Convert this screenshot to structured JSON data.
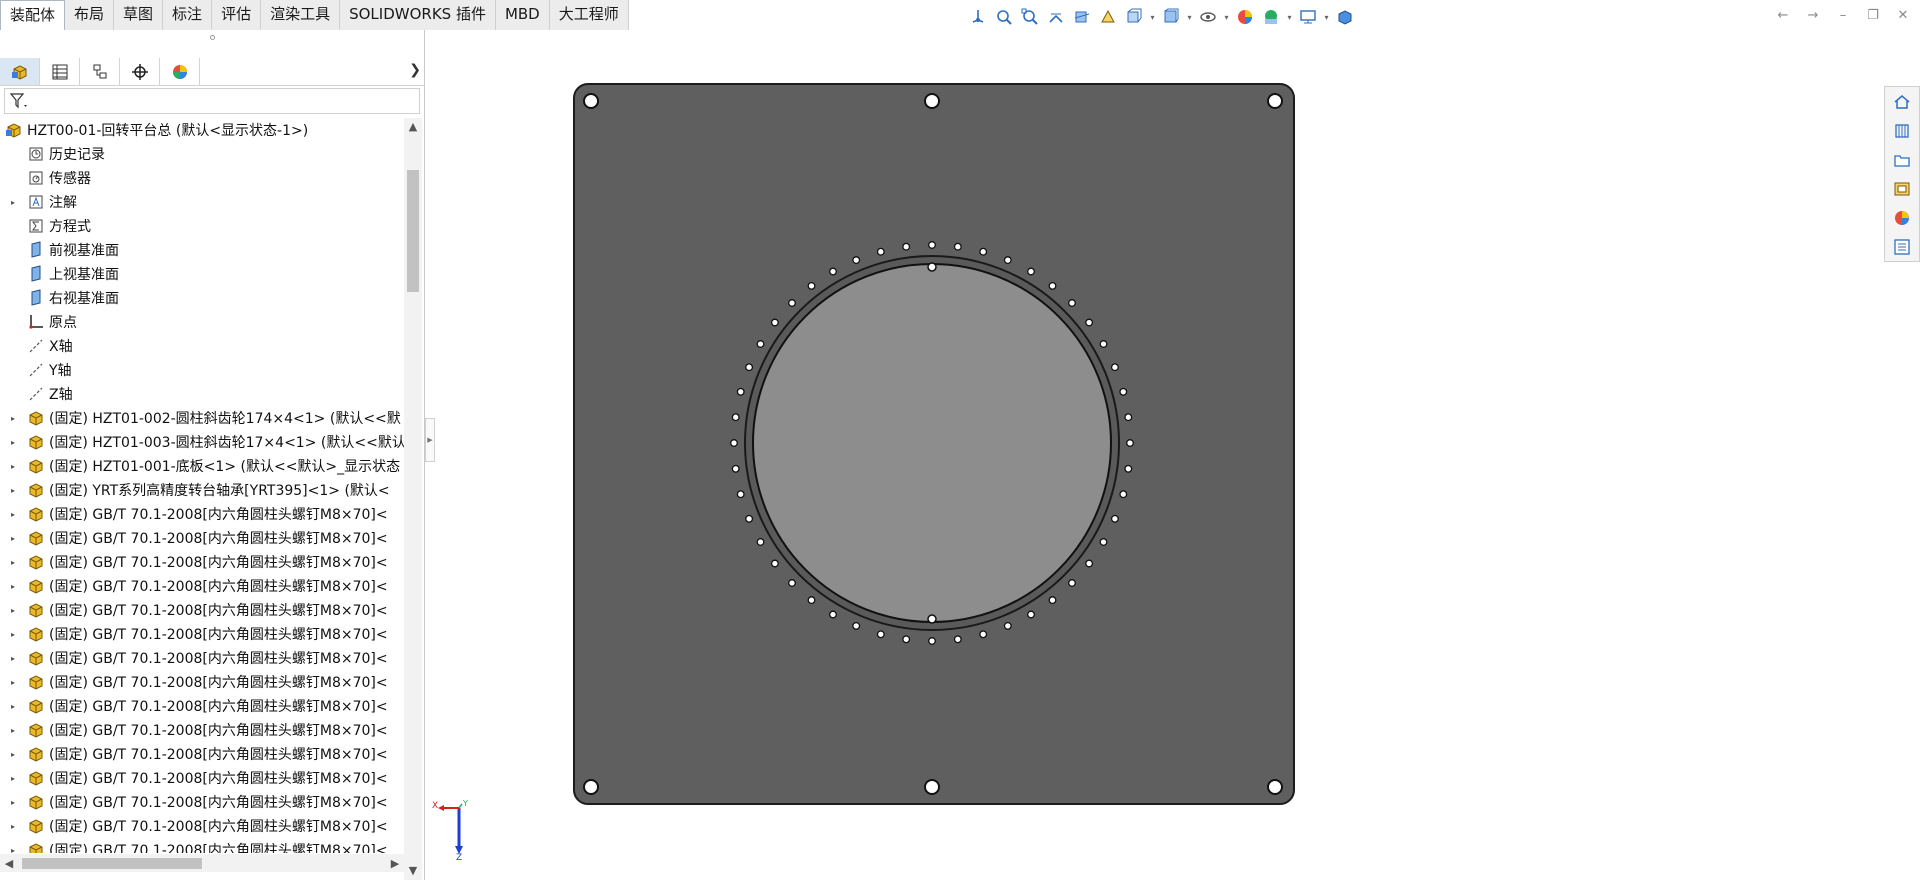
{
  "command_tabs": [
    "装配体",
    "布局",
    "草图",
    "标注",
    "评估",
    "渲染工具",
    "SOLIDWORKS 插件",
    "MBD",
    "大工程师"
  ],
  "active_tab": "装配体",
  "heads_up_toolbar": {
    "icons": [
      "view-orientation-icon",
      "zoom-to-fit-icon",
      "zoom-to-area-icon",
      "previous-view-icon",
      "section-view-icon",
      "dynamic-annotation-icon",
      "view-orientation-dropdown-icon",
      "display-style-icon",
      "hide-show-items-icon",
      "edit-appearance-icon",
      "apply-scene-icon",
      "view-settings-icon",
      "display-pane-icon"
    ]
  },
  "window_controls": [
    "restore-left-icon",
    "restore-right-icon",
    "minimize-icon",
    "restore-icon",
    "close-icon"
  ],
  "manager_tabs": [
    "featuremanager-icon",
    "propertymanager-icon",
    "configurationmanager-icon",
    "dimxpertmanager-icon",
    "displaymanager-icon"
  ],
  "tree": {
    "root": "HZT00-01-回转平台总  (默认<显示状态-1>)",
    "items": [
      {
        "label": "历史记录",
        "icon": "history-icon",
        "expandable": false
      },
      {
        "label": "传感器",
        "icon": "sensor-icon",
        "expandable": false
      },
      {
        "label": "注解",
        "icon": "annotation-icon",
        "expandable": true
      },
      {
        "label": "方程式",
        "icon": "equation-icon",
        "expandable": false
      },
      {
        "label": "前视基准面",
        "icon": "plane-icon",
        "expandable": false
      },
      {
        "label": "上视基准面",
        "icon": "plane-icon",
        "expandable": false
      },
      {
        "label": "右视基准面",
        "icon": "plane-icon",
        "expandable": false
      },
      {
        "label": "原点",
        "icon": "origin-icon",
        "expandable": false
      },
      {
        "label": "X轴",
        "icon": "axis-icon",
        "expandable": false
      },
      {
        "label": "Y轴",
        "icon": "axis-icon",
        "expandable": false
      },
      {
        "label": "Z轴",
        "icon": "axis-icon",
        "expandable": false
      },
      {
        "label": "(固定) HZT01-002-圆柱斜齿轮174×4<1> (默认<<默",
        "icon": "part-icon",
        "expandable": true
      },
      {
        "label": "(固定) HZT01-003-圆柱斜齿轮17×4<1> (默认<<默认",
        "icon": "part-icon",
        "expandable": true
      },
      {
        "label": "(固定) HZT01-001-底板<1> (默认<<默认>_显示状态",
        "icon": "part-icon",
        "expandable": true
      },
      {
        "label": "(固定) YRT系列高精度转台轴承[YRT395]<1> (默认<",
        "icon": "part-icon",
        "expandable": true
      },
      {
        "label": "(固定) GB∕T 70.1-2008[内六角圆柱头螺钉M8×70]<",
        "icon": "part-icon",
        "expandable": true
      },
      {
        "label": "(固定) GB∕T 70.1-2008[内六角圆柱头螺钉M8×70]<",
        "icon": "part-icon",
        "expandable": true
      },
      {
        "label": "(固定) GB∕T 70.1-2008[内六角圆柱头螺钉M8×70]<",
        "icon": "part-icon",
        "expandable": true
      },
      {
        "label": "(固定) GB∕T 70.1-2008[内六角圆柱头螺钉M8×70]<",
        "icon": "part-icon",
        "expandable": true
      },
      {
        "label": "(固定) GB∕T 70.1-2008[内六角圆柱头螺钉M8×70]<",
        "icon": "part-icon",
        "expandable": true
      },
      {
        "label": "(固定) GB∕T 70.1-2008[内六角圆柱头螺钉M8×70]<",
        "icon": "part-icon",
        "expandable": true
      },
      {
        "label": "(固定) GB∕T 70.1-2008[内六角圆柱头螺钉M8×70]<",
        "icon": "part-icon",
        "expandable": true
      },
      {
        "label": "(固定) GB∕T 70.1-2008[内六角圆柱头螺钉M8×70]<",
        "icon": "part-icon",
        "expandable": true
      },
      {
        "label": "(固定) GB∕T 70.1-2008[内六角圆柱头螺钉M8×70]<",
        "icon": "part-icon",
        "expandable": true
      },
      {
        "label": "(固定) GB∕T 70.1-2008[内六角圆柱头螺钉M8×70]<",
        "icon": "part-icon",
        "expandable": true
      },
      {
        "label": "(固定) GB∕T 70.1-2008[内六角圆柱头螺钉M8×70]<",
        "icon": "part-icon",
        "expandable": true
      },
      {
        "label": "(固定) GB∕T 70.1-2008[内六角圆柱头螺钉M8×70]<",
        "icon": "part-icon",
        "expandable": true
      },
      {
        "label": "(固定) GB∕T 70.1-2008[内六角圆柱头螺钉M8×70]<",
        "icon": "part-icon",
        "expandable": true
      },
      {
        "label": "(固定) GB∕T 70.1-2008[内六角圆柱头螺钉M8×70]<",
        "icon": "part-icon",
        "expandable": true
      },
      {
        "label": "(固定) GB∕T 70.1-2008[内六角圆柱头螺钉M8×70]<",
        "icon": "part-icon",
        "expandable": true
      }
    ]
  },
  "task_pane": [
    "solidworks-resources-icon",
    "design-library-icon",
    "file-explorer-icon",
    "view-palette-icon",
    "appearances-scenes-icon",
    "custom-properties-icon"
  ],
  "triad": {
    "x_label": "X",
    "y_label": "Y",
    "z_label": "Z"
  },
  "colors": {
    "plate": "#5f5f5f",
    "bearing_center": "#8d8d8d",
    "accent_blue": "#2f6fbf",
    "part_yellow": "#e9b82c"
  }
}
